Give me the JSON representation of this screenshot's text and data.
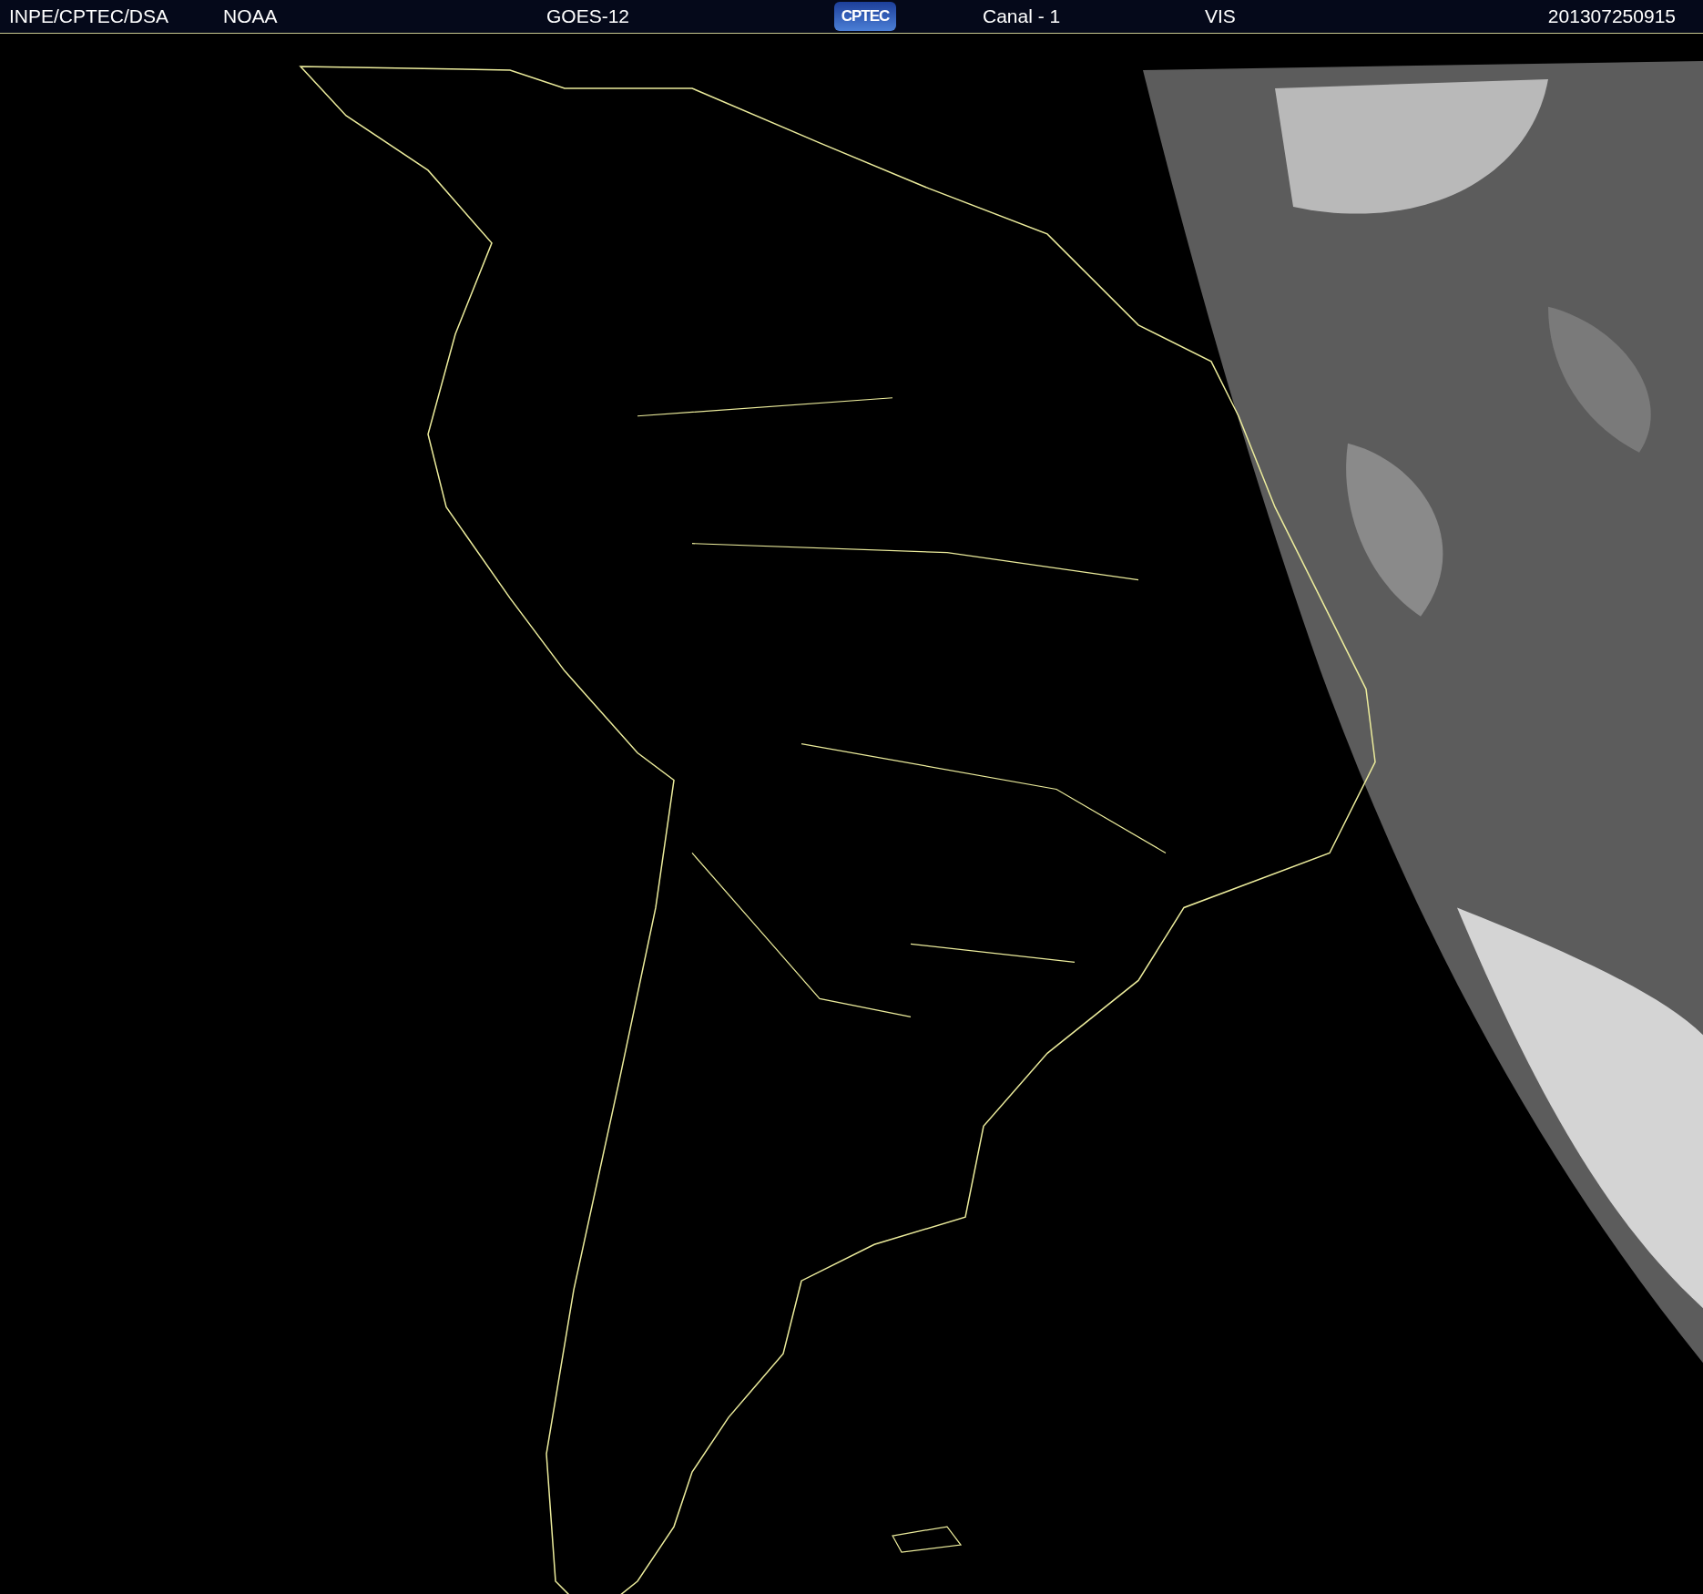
{
  "header": {
    "items": [
      "INPE/CPTEC/DSA",
      "NOAA",
      "GOES-12"
    ],
    "logo": "CPTEC",
    "channel": "Canal - 1",
    "band": "VIS",
    "timestamp": "201307250915"
  }
}
